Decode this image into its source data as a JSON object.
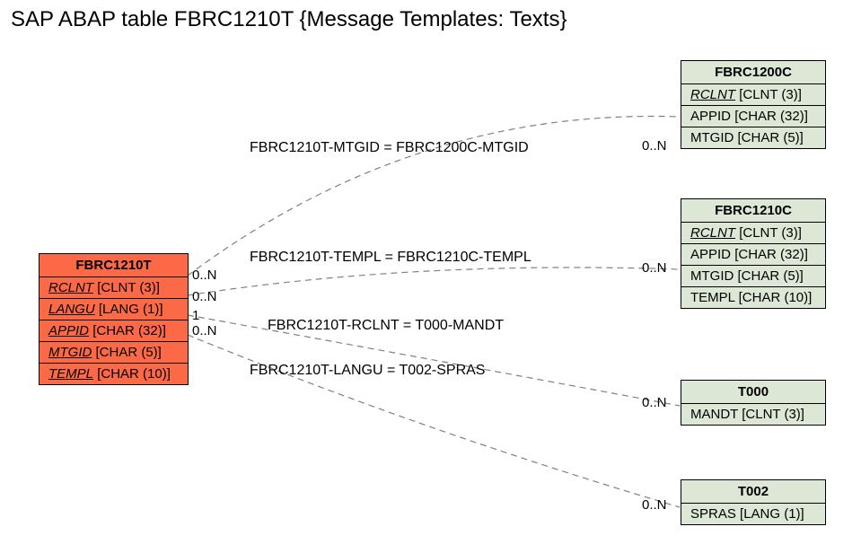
{
  "title": "SAP ABAP table FBRC1210T {Message Templates: Texts}",
  "main_entity": {
    "name": "FBRC1210T",
    "fields": [
      {
        "name": "RCLNT",
        "type": "[CLNT (3)]",
        "key": true
      },
      {
        "name": "LANGU",
        "type": "[LANG (1)]",
        "key": true
      },
      {
        "name": "APPID",
        "type": "[CHAR (32)]",
        "key": true
      },
      {
        "name": "MTGID",
        "type": "[CHAR (5)]",
        "key": true
      },
      {
        "name": "TEMPL",
        "type": "[CHAR (10)]",
        "key": true
      }
    ]
  },
  "related": [
    {
      "name": "FBRC1200C",
      "fields": [
        {
          "name": "RCLNT",
          "type": "[CLNT (3)]",
          "key": true
        },
        {
          "name": "APPID",
          "type": "[CHAR (32)]",
          "key": false
        },
        {
          "name": "MTGID",
          "type": "[CHAR (5)]",
          "key": false
        }
      ]
    },
    {
      "name": "FBRC1210C",
      "fields": [
        {
          "name": "RCLNT",
          "type": "[CLNT (3)]",
          "key": true
        },
        {
          "name": "APPID",
          "type": "[CHAR (32)]",
          "key": false
        },
        {
          "name": "MTGID",
          "type": "[CHAR (5)]",
          "key": false
        },
        {
          "name": "TEMPL",
          "type": "[CHAR (10)]",
          "key": false
        }
      ]
    },
    {
      "name": "T000",
      "fields": [
        {
          "name": "MANDT",
          "type": "[CLNT (3)]",
          "key": false
        }
      ]
    },
    {
      "name": "T002",
      "fields": [
        {
          "name": "SPRAS",
          "type": "[LANG (1)]",
          "key": false
        }
      ]
    }
  ],
  "relations": [
    {
      "label": "FBRC1210T-MTGID = FBRC1200C-MTGID",
      "left_card": "0..N",
      "right_card": "0..N"
    },
    {
      "label": "FBRC1210T-TEMPL = FBRC1210C-TEMPL",
      "left_card": "0..N",
      "right_card": "0..N"
    },
    {
      "label": "FBRC1210T-RCLNT = T000-MANDT",
      "left_card": "1",
      "right_card": "0..N"
    },
    {
      "label": "FBRC1210T-LANGU = T002-SPRAS",
      "left_card": "0..N",
      "right_card": "0..N"
    }
  ]
}
